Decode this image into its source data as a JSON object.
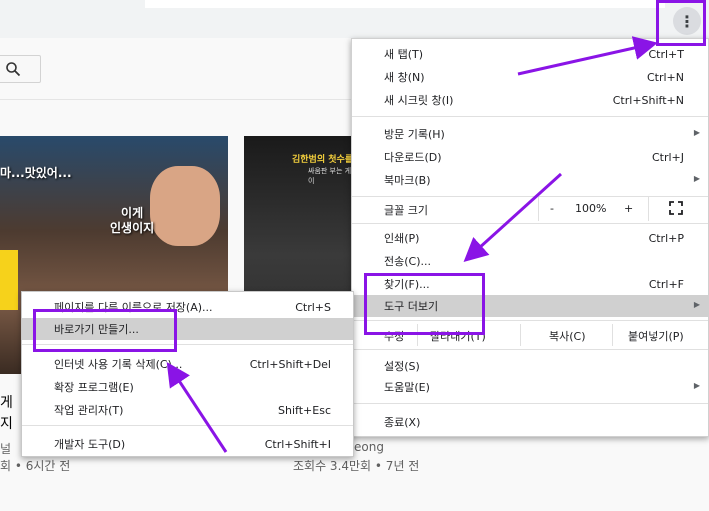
{
  "browser": {
    "menu_icon": "more-vert-icon",
    "menu_glyph": "⋮"
  },
  "page": {
    "search_icon": "search-icon",
    "video1": {
      "overlay_text1": "마...맛있어...",
      "overlay_text2a": "이게",
      "overlay_text2b": "인생이지",
      "title_line1": "게",
      "title_line2": "지",
      "channel": "널",
      "stats": "회 • 6시간 전"
    },
    "video2": {
      "overlay_title": "김한범의 첫수를",
      "overlay_sub": "싸움판 부는 게이",
      "channel": "eong",
      "stats": "조회수 3.4만회 • 7년 전"
    }
  },
  "chrome_menu": {
    "new_tab": {
      "label": "새 탭(T)",
      "shortcut": "Ctrl+T"
    },
    "new_window": {
      "label": "새 창(N)",
      "shortcut": "Ctrl+N"
    },
    "incognito": {
      "label": "새 시크릿 창(I)",
      "shortcut": "Ctrl+Shift+N"
    },
    "history": {
      "label": "방문 기록(H)"
    },
    "downloads": {
      "label": "다운로드(D)",
      "shortcut": "Ctrl+J"
    },
    "bookmarks": {
      "label": "북마크(B)"
    },
    "zoom": {
      "label": "글꼴 크기",
      "minus": "-",
      "value": "100%",
      "plus": "+"
    },
    "print": {
      "label": "인쇄(P)",
      "shortcut": "Ctrl+P"
    },
    "cast": {
      "label": "전송(C)..."
    },
    "find": {
      "label": "찾기(F)...",
      "shortcut": "Ctrl+F"
    },
    "more_tools": {
      "label": "도구 더보기"
    },
    "edit": {
      "label": "수정",
      "cut": "잘라내기(T)",
      "copy": "복사(C)",
      "paste": "붙여넣기(P)"
    },
    "settings": {
      "label": "설정(S)"
    },
    "help": {
      "label": "도움말(E)"
    },
    "exit": {
      "label": "종료(X)"
    }
  },
  "submenu": {
    "save_page": {
      "label": "페이지를 다른 이름으로 저장(A)...",
      "shortcut": "Ctrl+S"
    },
    "create_shortcut": {
      "label": "바로가기 만들기..."
    },
    "clear_data": {
      "label": "인터넷 사용 기록 삭제(C)...",
      "shortcut": "Ctrl+Shift+Del"
    },
    "extensions": {
      "label": "확장 프로그램(E)"
    },
    "task_manager": {
      "label": "작업 관리자(T)",
      "shortcut": "Shift+Esc"
    },
    "dev_tools": {
      "label": "개발자 도구(D)",
      "shortcut": "Ctrl+Shift+I"
    }
  },
  "colors": {
    "annotation": "#8a14e6",
    "highlight": "#d0d0d0"
  }
}
